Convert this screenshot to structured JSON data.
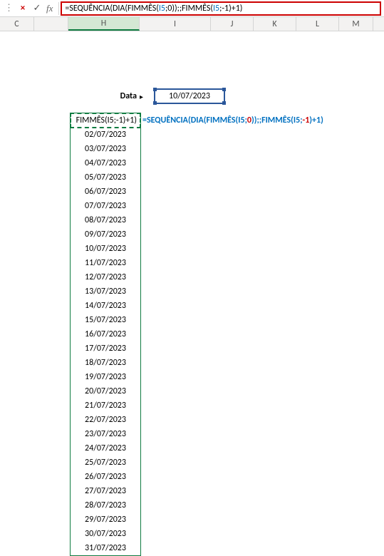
{
  "formula_bar": {
    "cancel_icon": "×",
    "enter_icon": "✓",
    "fx_icon": "fx",
    "formula_plain": "=SEQUÊNCIA(DIA(FIMMÊS(I5;0));;FIMMÊS(I5;-1)+1)",
    "p": {
      "eq": "=",
      "SEQ": "SEQUÊNCIA",
      "op": "(",
      "DIA": "DIA",
      "op2": "(",
      "FIM1": "FIMMÊS",
      "op3": "(",
      "I5a": "I5",
      "sc1": ";",
      "z0": "0",
      "cp1": ")",
      "cp2": ")",
      "sc2": ";;",
      "FIM2": "FIMMÊS",
      "op4": "(",
      "I5b": "I5",
      "sc3": ";",
      "m1": "-1",
      "cp3": ")",
      "plus1": "+1",
      "cp4": ")"
    }
  },
  "columns": [
    "C",
    "H",
    "I",
    "J",
    "K",
    "L",
    "M"
  ],
  "selected_col": "H",
  "input": {
    "label": "Data",
    "arrow": "▸",
    "value": "10/07/2023"
  },
  "first_cell": "FIMMÊS(I5;-1)+1)",
  "side": {
    "eq": "=",
    "t1": "SEQUÊNCIA(DIA(FIMMÊS(I5;",
    "n0": "0",
    "t2": "));;FIMMÊS(I5;",
    "nm1": "-1",
    "t3": ")",
    "plus": "+1",
    "t4": ")"
  },
  "dates": [
    "02/07/2023",
    "03/07/2023",
    "04/07/2023",
    "05/07/2023",
    "06/07/2023",
    "07/07/2023",
    "08/07/2023",
    "09/07/2023",
    "10/07/2023",
    "11/07/2023",
    "12/07/2023",
    "13/07/2023",
    "14/07/2023",
    "15/07/2023",
    "16/07/2023",
    "17/07/2023",
    "18/07/2023",
    "19/07/2023",
    "20/07/2023",
    "21/07/2023",
    "22/07/2023",
    "23/07/2023",
    "24/07/2023",
    "25/07/2023",
    "26/07/2023",
    "27/07/2023",
    "28/07/2023",
    "29/07/2023",
    "30/07/2023",
    "31/07/2023"
  ]
}
